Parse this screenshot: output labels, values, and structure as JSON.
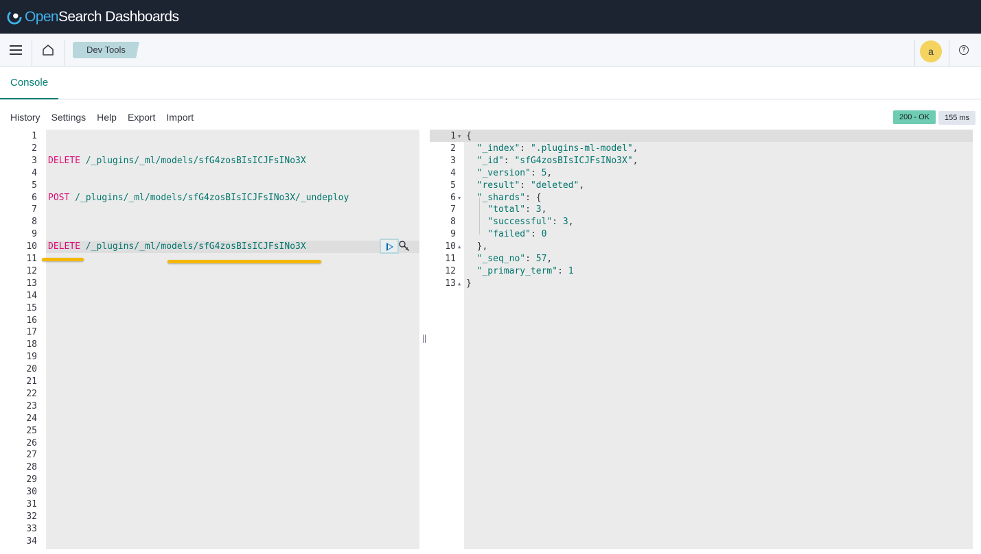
{
  "app": {
    "logo_open": "Open",
    "logo_rest": "Search Dashboards"
  },
  "nav": {
    "breadcrumb": "Dev Tools",
    "avatar_letter": "a"
  },
  "tabs": {
    "console": "Console"
  },
  "console_menu": [
    "History",
    "Settings",
    "Help",
    "Export",
    "Import"
  ],
  "status": {
    "code": "200 - OK",
    "time": "155 ms"
  },
  "request_editor": {
    "line_count": 34,
    "active_line": 10,
    "lines": [
      {
        "n": 3,
        "method": "DELETE",
        "path": " /_plugins/_ml/models/sfG4zosBIsICJFsINo3X"
      },
      {
        "n": 6,
        "method": "POST",
        "path": " /_plugins/_ml/models/sfG4zosBIsICJFsINo3X/_undeploy"
      },
      {
        "n": 10,
        "method": "DELETE",
        "path": " /_plugins/_ml/models/sfG4zosBIsICJFsINo3X"
      }
    ]
  },
  "response_editor": {
    "lines": [
      "{",
      "  \"_index\": \".plugins-ml-model\",",
      "  \"_id\": \"sfG4zosBIsICJFsINo3X\",",
      "  \"_version\": 5,",
      "  \"result\": \"deleted\",",
      "  \"_shards\": {",
      "    \"total\": 3,",
      "    \"successful\": 3,",
      "    \"failed\": 0",
      "  },",
      "  \"_seq_no\": 57,",
      "  \"_primary_term\": 1",
      "}"
    ],
    "fold_lines": {
      "1": "down",
      "6": "down",
      "10": "up",
      "13": "up"
    }
  },
  "colors": {
    "header_bg": "#1c2331",
    "accent": "#017d73",
    "method": "#dd0a73",
    "highlight": "#f5b800"
  }
}
